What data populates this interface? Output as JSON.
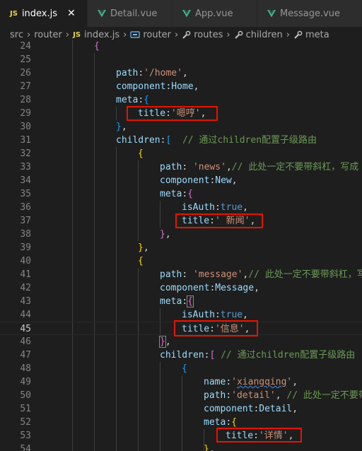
{
  "tabs": [
    {
      "label": "index.js",
      "icon": "js-icon",
      "active": true
    },
    {
      "label": "Detail.vue",
      "icon": "vue-icon"
    },
    {
      "label": "App.vue",
      "icon": "vue-icon"
    },
    {
      "label": "Message.vue",
      "icon": "vue-icon"
    }
  ],
  "tab_close": "✕",
  "js_badge": "JS",
  "breadcrumb": [
    "src",
    "router",
    "index.js",
    "router",
    "routes",
    "children",
    "meta"
  ],
  "current_line": "45",
  "lines": [
    {
      "n": "24",
      "t": "{"
    },
    {
      "n": "25",
      "t": ""
    },
    {
      "n": "26",
      "t": "path:'/home',"
    },
    {
      "n": "27",
      "t": "component:Home,"
    },
    {
      "n": "28",
      "t": "meta:{"
    },
    {
      "n": "29",
      "t": "title:'嗯哼',"
    },
    {
      "n": "30",
      "t": "},"
    },
    {
      "n": "31",
      "t": "children:[  // 通过children配置子级路由"
    },
    {
      "n": "32",
      "t": "{"
    },
    {
      "n": "33",
      "t": "path: 'news',// 此处一定不要带斜杠，写成"
    },
    {
      "n": "34",
      "t": "component:New,"
    },
    {
      "n": "35",
      "t": "meta:{"
    },
    {
      "n": "36",
      "t": "isAuth:true,"
    },
    {
      "n": "37",
      "t": "title:' 新闻',"
    },
    {
      "n": "38",
      "t": "},"
    },
    {
      "n": "39",
      "t": "},"
    },
    {
      "n": "40",
      "t": "{"
    },
    {
      "n": "41",
      "t": "path: 'message',// 此处一定不要带斜杠，写"
    },
    {
      "n": "42",
      "t": "component:Message,"
    },
    {
      "n": "43",
      "t": "meta:{"
    },
    {
      "n": "44",
      "t": "isAuth:true,"
    },
    {
      "n": "45",
      "t": "title:'信息',"
    },
    {
      "n": "46",
      "t": "},"
    },
    {
      "n": "47",
      "t": "children:[ // 通过children配置子级路由"
    },
    {
      "n": "48",
      "t": "{"
    },
    {
      "n": "49",
      "t": "name:'xiangqing',"
    },
    {
      "n": "50",
      "t": "path:'detail', // 此处一定不要带"
    },
    {
      "n": "51",
      "t": "component:Detail,"
    },
    {
      "n": "52",
      "t": "meta:{"
    },
    {
      "n": "53",
      "t": "title:'详情',"
    },
    {
      "n": "54",
      "t": "},"
    }
  ],
  "colors": {
    "background": "#1e1e1e",
    "key": "#9cdcfe",
    "string": "#ce9178",
    "comment": "#6a9955",
    "keyword": "#569cd6",
    "bracket_gold": "#ffd700",
    "bracket_purple": "#da70d6",
    "bracket_blue": "#179fff",
    "highlight_box": "#e51400",
    "vue_green": "#41b883"
  }
}
